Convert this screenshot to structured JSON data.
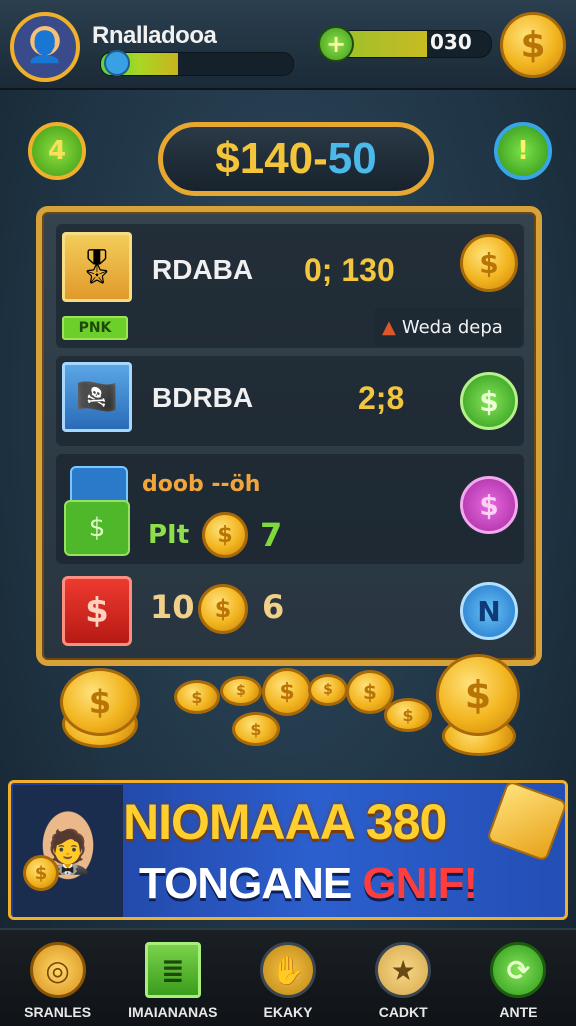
{
  "header": {
    "player_name": "Rnalladooa",
    "xp_value": "030",
    "plus_icon": "+",
    "coin_icon": "$",
    "level_progress": 0.4,
    "xp_progress": 0.58
  },
  "hud": {
    "level_badge": "4",
    "info_badge": "!",
    "balance_primary": "$140",
    "balance_separator": " - ",
    "balance_secondary": "50"
  },
  "board": {
    "rows": [
      {
        "name": "RDABA",
        "score": "0; 130",
        "tag": "PNK",
        "notice": "Weda depa",
        "portrait_icon": "🎖",
        "action_icon": "$"
      },
      {
        "name": "BDRBA",
        "score": "2;8",
        "portrait_icon": "🏴‍☠️",
        "action_icon": "$"
      },
      {
        "title": "doob --öh",
        "label": "PIt",
        "value": "7",
        "card_icon": "$",
        "action_icon": "$"
      },
      {
        "left_value": "10",
        "right_value": "6",
        "card_icon": "$",
        "action_icon": "N"
      }
    ]
  },
  "banner": {
    "line1": "NIOMAAA 380",
    "line2_main": "TONGANE ",
    "line2_accent": "GNIF!",
    "coin_icon": "$"
  },
  "nav": {
    "items": [
      {
        "label": "SRANLES",
        "icon": "◎"
      },
      {
        "label": "IMAIANANAS",
        "icon": "≣"
      },
      {
        "label": "EKAKY",
        "icon": "✋"
      },
      {
        "label": "CADKT",
        "icon": "★"
      },
      {
        "label": "ANTE",
        "icon": "⟳"
      }
    ]
  },
  "colors": {
    "gold": "#f0b02b",
    "balance_gold": "#f4c43a",
    "balance_blue": "#4bb9ea",
    "banner_yellow": "#ffcf2e",
    "banner_red": "#ff3d3d"
  }
}
